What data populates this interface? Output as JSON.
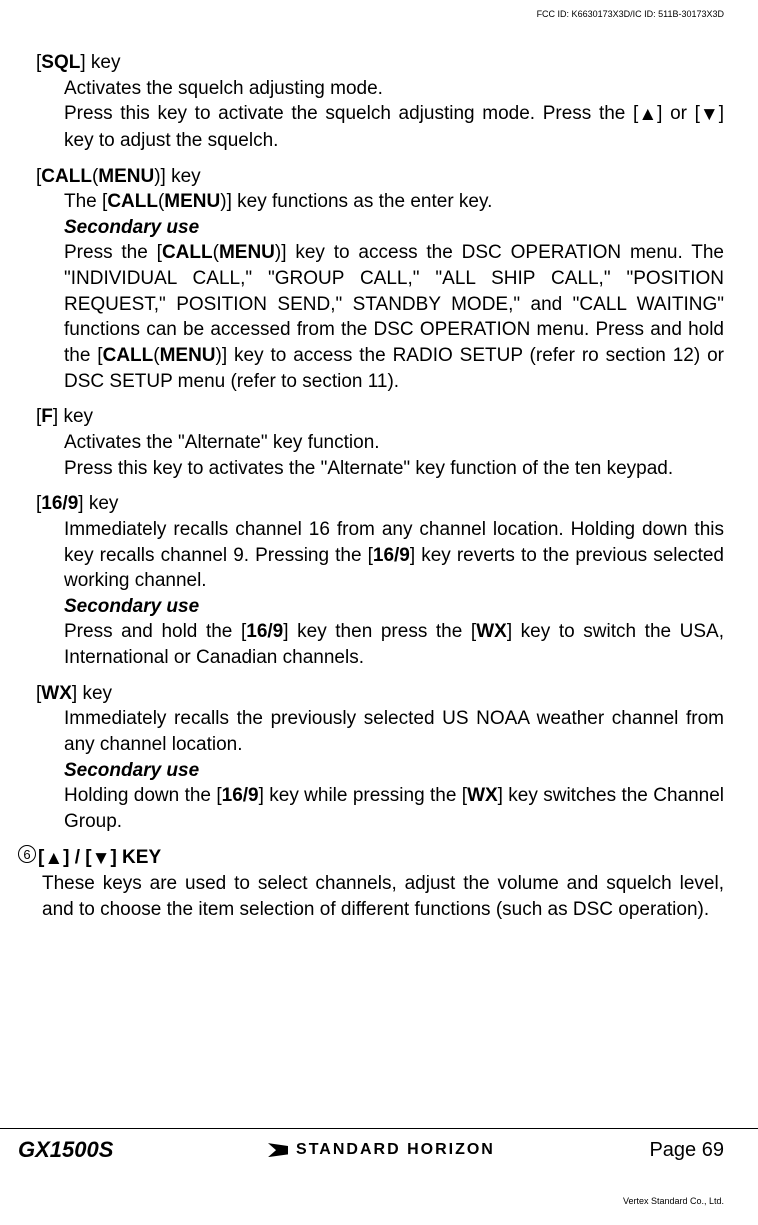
{
  "fcc": "FCC ID: K6630173X3D/IC ID: 511B-30173X3D",
  "sql": {
    "head_pre": "[",
    "head_key": "SQL",
    "head_post": "] key",
    "l1": "Activates the squelch adjusting mode.",
    "l2a": "Press this key to activate the squelch adjusting mode. Press the [",
    "l2b": "] or [",
    "l2c": "] key to adjust the squelch."
  },
  "call": {
    "head": "[CALL(MENU)] key",
    "l1a": "The [",
    "l1b": "CALL",
    "l1c": "(",
    "l1d": "MENU",
    "l1e": ")] key functions as the enter key.",
    "sec": "Secondary use",
    "l2a": "Press the [",
    "l2b": "CALL",
    "l2c": "(",
    "l2d": "MENU",
    "l2e": ")] key to access the DSC OPERATION menu. The \"INDIVIDUAL CALL,\" \"GROUP CALL,\" \"ALL SHIP CALL,\" \"POSITION REQUEST,\" POSITION SEND,\" STANDBY MODE,\" and \"CALL WAITING\" functions can be accessed from the DSC OPERATION menu. Press and hold the [",
    "l2f": "CALL",
    "l2g": "(",
    "l2h": "MENU",
    "l2i": ")] key to access the RADIO SETUP (refer ro section 12) or DSC SETUP menu (refer to section 11)."
  },
  "f": {
    "head_pre": "[",
    "head_key": "F",
    "head_post": "] key",
    "l1": "Activates the \"Alternate\" key function.",
    "l2": "Press this key to activates the \"Alternate\" key function of the ten keypad."
  },
  "k169": {
    "head_pre": "[",
    "head_key": "16/9",
    "head_post": "] key",
    "l1a": "Immediately recalls channel 16 from any channel location. Holding down this key recalls channel 9. Pressing the [",
    "l1b": "16/9",
    "l1c": "] key reverts to the previous selected working channel.",
    "sec": "Secondary use",
    "l2a": "Press and hold the [",
    "l2b": "16/9",
    "l2c": "] key then press the [",
    "l2d": "WX",
    "l2e": "] key to switch the USA, International or Canadian channels."
  },
  "wx": {
    "head_pre": "[",
    "head_key": "WX",
    "head_post": "] key",
    "l1": "Immediately recalls the previously selected US NOAA weather channel from any channel location.",
    "sec": "Secondary use",
    "l2a": "Holding down the [",
    "l2b": "16/9",
    "l2c": "] key while pressing the [",
    "l2d": "WX",
    "l2e": "] key switches the Channel Group."
  },
  "item6": {
    "num": "6",
    "head_a": "[",
    "head_b": "] / [",
    "head_c": "] KEY",
    "body": "These keys are used to select channels, adjust the volume and squelch level, and to choose the item selection of different functions (such as DSC operation)."
  },
  "footer": {
    "model": "GX1500S",
    "brand": "STANDARD HORIZON",
    "page": "Page 69"
  },
  "vertex": "Vertex Standard Co., Ltd."
}
